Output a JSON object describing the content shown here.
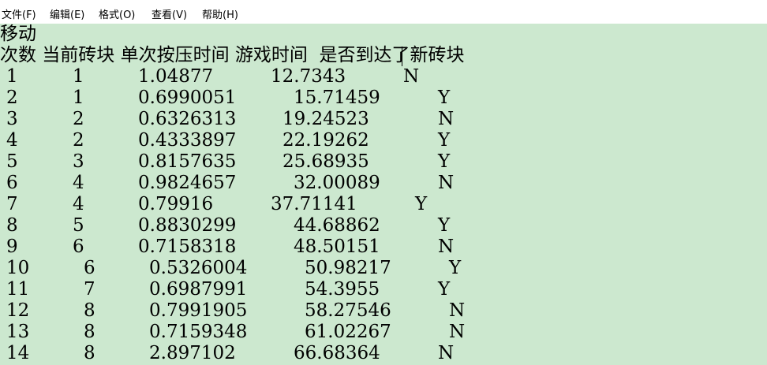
{
  "menu": [
    "文件(F)",
    "编辑(E)",
    "格式(O)",
    "查看(V)",
    "帮助(H)"
  ],
  "header_line1": "移动",
  "header_line2": "次数 当前砖块 单次按压时间 游戏时间  是否到达了新砖块",
  "rows": [
    [
      "1",
      "1",
      "1.04877",
      "12.7343",
      "N"
    ],
    [
      "2",
      "1",
      "0.6990051",
      "15.71459",
      "Y"
    ],
    [
      "3",
      "2",
      "0.6326313",
      "19.24523",
      "N"
    ],
    [
      "4",
      "2",
      "0.4333897",
      "22.19262",
      "Y"
    ],
    [
      "5",
      "3",
      "0.8157635",
      "25.68935",
      "Y"
    ],
    [
      "6",
      "4",
      "0.9824657",
      "32.00089",
      "N"
    ],
    [
      "7",
      "4",
      "0.79916",
      "37.71141",
      "Y"
    ],
    [
      "8",
      "5",
      "0.8830299",
      "44.68862",
      "Y"
    ],
    [
      "9",
      "6",
      "0.7158318",
      "48.50151",
      "N"
    ],
    [
      "10",
      "6",
      "0.5326004",
      "50.98217",
      "Y"
    ],
    [
      "11",
      "7",
      "0.6987991",
      "54.3955",
      "Y"
    ],
    [
      "12",
      "8",
      "0.7991905",
      "58.27546",
      "N"
    ],
    [
      "13",
      "8",
      "0.7159348",
      "61.02267",
      "N"
    ],
    [
      "14",
      "8",
      "2.897102",
      "66.68364",
      "N"
    ]
  ]
}
